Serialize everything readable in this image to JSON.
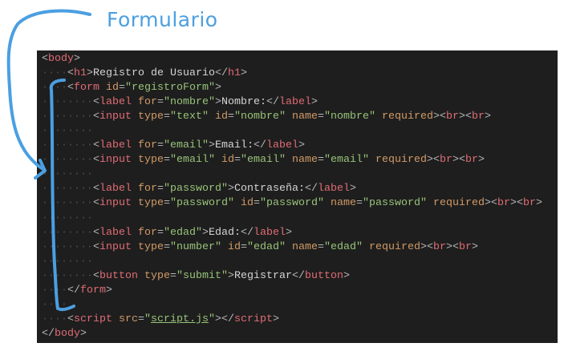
{
  "annotation": {
    "title": "Formulario",
    "color": "#4b9fe1"
  },
  "editor": {
    "background": "#1e1e1e",
    "lines": [
      [
        [
          "punct",
          "<"
        ],
        [
          "tag",
          "body"
        ],
        [
          "punct",
          ">"
        ]
      ],
      [
        [
          "ind",
          "····"
        ],
        [
          "punct",
          "<"
        ],
        [
          "tag",
          "h1"
        ],
        [
          "punct",
          ">"
        ],
        [
          "text",
          "Registro de Usuario"
        ],
        [
          "punct",
          "</"
        ],
        [
          "tag",
          "h1"
        ],
        [
          "punct",
          ">"
        ]
      ],
      [
        [
          "ind",
          "····"
        ],
        [
          "punct",
          "<"
        ],
        [
          "tag",
          "form"
        ],
        [
          "text",
          " "
        ],
        [
          "attr",
          "id"
        ],
        [
          "punct",
          "="
        ],
        [
          "str",
          "\"registroForm\""
        ],
        [
          "punct",
          ">"
        ]
      ],
      [
        [
          "ind",
          "········"
        ],
        [
          "punct",
          "<"
        ],
        [
          "tag",
          "label"
        ],
        [
          "text",
          " "
        ],
        [
          "attr",
          "for"
        ],
        [
          "punct",
          "="
        ],
        [
          "str",
          "\"nombre\""
        ],
        [
          "punct",
          ">"
        ],
        [
          "text",
          "Nombre:"
        ],
        [
          "punct",
          "</"
        ],
        [
          "tag",
          "label"
        ],
        [
          "punct",
          ">"
        ]
      ],
      [
        [
          "ind",
          "········"
        ],
        [
          "punct",
          "<"
        ],
        [
          "tag",
          "input"
        ],
        [
          "text",
          " "
        ],
        [
          "attr",
          "type"
        ],
        [
          "punct",
          "="
        ],
        [
          "str",
          "\"text\""
        ],
        [
          "text",
          " "
        ],
        [
          "attr",
          "id"
        ],
        [
          "punct",
          "="
        ],
        [
          "str",
          "\"nombre\""
        ],
        [
          "text",
          " "
        ],
        [
          "attr",
          "name"
        ],
        [
          "punct",
          "="
        ],
        [
          "str",
          "\"nombre\""
        ],
        [
          "text",
          " "
        ],
        [
          "attr",
          "required"
        ],
        [
          "punct",
          ">"
        ],
        [
          "punct",
          "<"
        ],
        [
          "tag",
          "br"
        ],
        [
          "punct",
          ">"
        ],
        [
          "punct",
          "<"
        ],
        [
          "tag",
          "br"
        ],
        [
          "punct",
          ">"
        ]
      ],
      [
        [
          "ind",
          "········"
        ]
      ],
      [
        [
          "ind",
          "········"
        ],
        [
          "punct",
          "<"
        ],
        [
          "tag",
          "label"
        ],
        [
          "text",
          " "
        ],
        [
          "attr",
          "for"
        ],
        [
          "punct",
          "="
        ],
        [
          "str",
          "\"email\""
        ],
        [
          "punct",
          ">"
        ],
        [
          "text",
          "Email:"
        ],
        [
          "punct",
          "</"
        ],
        [
          "tag",
          "label"
        ],
        [
          "punct",
          ">"
        ]
      ],
      [
        [
          "ind",
          "········"
        ],
        [
          "punct",
          "<"
        ],
        [
          "tag",
          "input"
        ],
        [
          "text",
          " "
        ],
        [
          "attr",
          "type"
        ],
        [
          "punct",
          "="
        ],
        [
          "str",
          "\"email\""
        ],
        [
          "text",
          " "
        ],
        [
          "attr",
          "id"
        ],
        [
          "punct",
          "="
        ],
        [
          "str",
          "\"email\""
        ],
        [
          "text",
          " "
        ],
        [
          "attr",
          "name"
        ],
        [
          "punct",
          "="
        ],
        [
          "str",
          "\"email\""
        ],
        [
          "text",
          " "
        ],
        [
          "attr",
          "required"
        ],
        [
          "punct",
          ">"
        ],
        [
          "punct",
          "<"
        ],
        [
          "tag",
          "br"
        ],
        [
          "punct",
          ">"
        ],
        [
          "punct",
          "<"
        ],
        [
          "tag",
          "br"
        ],
        [
          "punct",
          ">"
        ]
      ],
      [
        [
          "ind",
          "········"
        ]
      ],
      [
        [
          "ind",
          "········"
        ],
        [
          "punct",
          "<"
        ],
        [
          "tag",
          "label"
        ],
        [
          "text",
          " "
        ],
        [
          "attr",
          "for"
        ],
        [
          "punct",
          "="
        ],
        [
          "str",
          "\"password\""
        ],
        [
          "punct",
          ">"
        ],
        [
          "text",
          "Contraseña:"
        ],
        [
          "punct",
          "</"
        ],
        [
          "tag",
          "label"
        ],
        [
          "punct",
          ">"
        ]
      ],
      [
        [
          "ind",
          "········"
        ],
        [
          "punct",
          "<"
        ],
        [
          "tag",
          "input"
        ],
        [
          "text",
          " "
        ],
        [
          "attr",
          "type"
        ],
        [
          "punct",
          "="
        ],
        [
          "str",
          "\"password\""
        ],
        [
          "text",
          " "
        ],
        [
          "attr",
          "id"
        ],
        [
          "punct",
          "="
        ],
        [
          "str",
          "\"password\""
        ],
        [
          "text",
          " "
        ],
        [
          "attr",
          "name"
        ],
        [
          "punct",
          "="
        ],
        [
          "str",
          "\"password\""
        ],
        [
          "text",
          " "
        ],
        [
          "attr",
          "required"
        ],
        [
          "punct",
          ">"
        ],
        [
          "punct",
          "<"
        ],
        [
          "tag",
          "br"
        ],
        [
          "punct",
          ">"
        ],
        [
          "punct",
          "<"
        ],
        [
          "tag",
          "br"
        ],
        [
          "punct",
          ">"
        ]
      ],
      [
        [
          "ind",
          "········"
        ]
      ],
      [
        [
          "ind",
          "········"
        ],
        [
          "punct",
          "<"
        ],
        [
          "tag",
          "label"
        ],
        [
          "text",
          " "
        ],
        [
          "attr",
          "for"
        ],
        [
          "punct",
          "="
        ],
        [
          "str",
          "\"edad\""
        ],
        [
          "punct",
          ">"
        ],
        [
          "text",
          "Edad:"
        ],
        [
          "punct",
          "</"
        ],
        [
          "tag",
          "label"
        ],
        [
          "punct",
          ">"
        ]
      ],
      [
        [
          "ind",
          "········"
        ],
        [
          "punct",
          "<"
        ],
        [
          "tag",
          "input"
        ],
        [
          "text",
          " "
        ],
        [
          "attr",
          "type"
        ],
        [
          "punct",
          "="
        ],
        [
          "str",
          "\"number\""
        ],
        [
          "text",
          " "
        ],
        [
          "attr",
          "id"
        ],
        [
          "punct",
          "="
        ],
        [
          "str",
          "\"edad\""
        ],
        [
          "text",
          " "
        ],
        [
          "attr",
          "name"
        ],
        [
          "punct",
          "="
        ],
        [
          "str",
          "\"edad\""
        ],
        [
          "text",
          " "
        ],
        [
          "attr",
          "required"
        ],
        [
          "punct",
          ">"
        ],
        [
          "punct",
          "<"
        ],
        [
          "tag",
          "br"
        ],
        [
          "punct",
          ">"
        ],
        [
          "punct",
          "<"
        ],
        [
          "tag",
          "br"
        ],
        [
          "punct",
          ">"
        ]
      ],
      [
        [
          "ind",
          "········"
        ]
      ],
      [
        [
          "ind",
          "········"
        ],
        [
          "punct",
          "<"
        ],
        [
          "tag",
          "button"
        ],
        [
          "text",
          " "
        ],
        [
          "attr",
          "type"
        ],
        [
          "punct",
          "="
        ],
        [
          "str",
          "\"submit\""
        ],
        [
          "punct",
          ">"
        ],
        [
          "text",
          "Registrar"
        ],
        [
          "punct",
          "</"
        ],
        [
          "tag",
          "button"
        ],
        [
          "punct",
          ">"
        ]
      ],
      [
        [
          "ind",
          "····"
        ],
        [
          "punct",
          "</"
        ],
        [
          "tag",
          "form"
        ],
        [
          "punct",
          ">"
        ]
      ],
      [
        [
          "ind",
          "····"
        ]
      ],
      [
        [
          "ind",
          "····"
        ],
        [
          "punct",
          "<"
        ],
        [
          "tag",
          "script"
        ],
        [
          "text",
          " "
        ],
        [
          "attr",
          "src"
        ],
        [
          "punct",
          "="
        ],
        [
          "str",
          "\""
        ],
        [
          "link",
          "script.js"
        ],
        [
          "str",
          "\""
        ],
        [
          "punct",
          ">"
        ],
        [
          "punct",
          "</"
        ],
        [
          "tag",
          "script"
        ],
        [
          "punct",
          ">"
        ]
      ],
      [
        [
          "punct",
          "</"
        ],
        [
          "tag",
          "body"
        ],
        [
          "punct",
          ">"
        ]
      ]
    ]
  }
}
